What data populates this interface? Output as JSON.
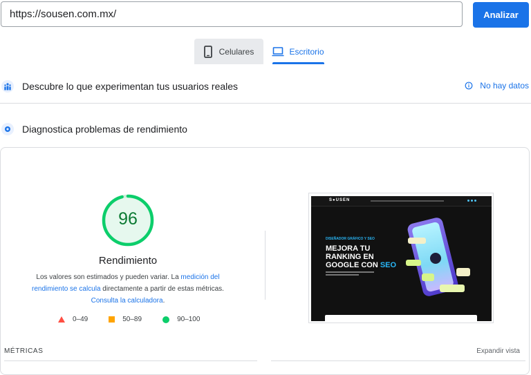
{
  "url_bar": {
    "value": "https://sousen.com.mx/",
    "button": "Analizar"
  },
  "tabs": [
    {
      "label": "Celulares"
    },
    {
      "label": "Escritorio",
      "active": true
    }
  ],
  "field_data": {
    "title": "Descubre lo que experimentan tus usuarios reales",
    "status": "No hay datos"
  },
  "lab_data": {
    "title": "Diagnostica problemas de rendimiento"
  },
  "score": {
    "value": "96",
    "fraction": 0.96,
    "label": "Rendimiento",
    "color": "#0cce6b"
  },
  "description": {
    "t1": "Los valores son estimados y pueden variar. La ",
    "link1": "medición del rendimiento se calcula",
    "t2": " directamente a partir de estas métricas. ",
    "link2": "Consulta la calculadora",
    "t3": "."
  },
  "legend": [
    {
      "range": "0–49",
      "color": "#ff4e42",
      "shape": "triangle"
    },
    {
      "range": "50–89",
      "color": "#ffa400",
      "shape": "square"
    },
    {
      "range": "90–100",
      "color": "#0cce6b",
      "shape": "circle"
    }
  ],
  "thumbnail": {
    "logo": "S●USEN",
    "eyebrow": "DISEÑADOR GRÁFICO Y SEO",
    "heading_line1": "MEJORA TU",
    "heading_line2": "RANKING EN",
    "heading_line3a": "GOOGLE CON ",
    "heading_line3b": "SEO"
  },
  "metrics": {
    "label": "MÉTRICAS",
    "expand": "Expandir vista"
  }
}
